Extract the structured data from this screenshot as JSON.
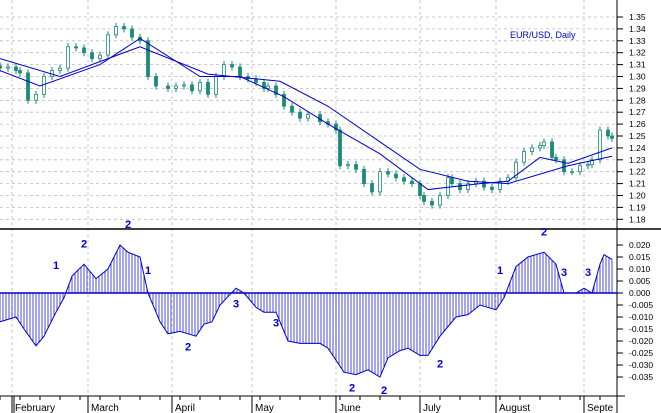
{
  "chart_data": [
    {
      "type": "candlestick",
      "title": "EUR/USD, Daily",
      "x_unit": "trading day index",
      "xlim": [
        0,
        153
      ],
      "ylim": [
        1.175,
        1.365
      ],
      "y_ticks": [
        "1.35",
        "1.34",
        "1.33",
        "1.32",
        "1.31",
        "1.30",
        "1.29",
        "1.28",
        "1.27",
        "1.26",
        "1.25",
        "1.24",
        "1.23",
        "1.22",
        "1.21",
        "1.20",
        "1.19",
        "1.18"
      ],
      "grid": true,
      "close": [
        [
          0,
          1.307
        ],
        [
          2,
          1.308
        ],
        [
          4,
          1.305
        ],
        [
          5,
          1.303
        ],
        [
          7,
          1.28
        ],
        [
          9,
          1.285
        ],
        [
          11,
          1.3
        ],
        [
          13,
          1.305
        ],
        [
          15,
          1.307
        ],
        [
          17,
          1.325
        ],
        [
          19,
          1.324
        ],
        [
          21,
          1.32
        ],
        [
          23,
          1.315
        ],
        [
          25,
          1.318
        ],
        [
          27,
          1.335
        ],
        [
          29,
          1.342
        ],
        [
          31,
          1.34
        ],
        [
          33,
          1.333
        ],
        [
          35,
          1.33
        ],
        [
          37,
          1.3
        ],
        [
          39,
          1.292
        ],
        [
          42,
          1.29
        ],
        [
          44,
          1.292
        ],
        [
          46,
          1.293
        ],
        [
          48,
          1.288
        ],
        [
          50,
          1.295
        ],
        [
          52,
          1.285
        ],
        [
          54,
          1.3
        ],
        [
          56,
          1.31
        ],
        [
          58,
          1.308
        ],
        [
          60,
          1.3
        ],
        [
          62,
          1.298
        ],
        [
          64,
          1.295
        ],
        [
          66,
          1.29
        ],
        [
          67,
          1.292
        ],
        [
          69,
          1.285
        ],
        [
          71,
          1.275
        ],
        [
          73,
          1.27
        ],
        [
          75,
          1.265
        ],
        [
          77,
          1.268
        ],
        [
          80,
          1.262
        ],
        [
          82,
          1.26
        ],
        [
          84,
          1.255
        ],
        [
          85,
          1.225
        ],
        [
          87,
          1.226
        ],
        [
          89,
          1.222
        ],
        [
          91,
          1.21
        ],
        [
          93,
          1.203
        ],
        [
          95,
          1.22
        ],
        [
          97,
          1.218
        ],
        [
          99,
          1.215
        ],
        [
          101,
          1.212
        ],
        [
          103,
          1.21
        ],
        [
          105,
          1.2
        ],
        [
          106,
          1.195
        ],
        [
          108,
          1.192
        ],
        [
          110,
          1.2
        ],
        [
          112,
          1.215
        ],
        [
          113,
          1.21
        ],
        [
          115,
          1.205
        ],
        [
          117,
          1.21
        ],
        [
          119,
          1.212
        ],
        [
          121,
          1.207
        ],
        [
          123,
          1.205
        ],
        [
          125,
          1.212
        ],
        [
          127,
          1.215
        ],
        [
          129,
          1.228
        ],
        [
          131,
          1.237
        ],
        [
          133,
          1.24
        ],
        [
          135,
          1.242
        ],
        [
          136,
          1.245
        ],
        [
          138,
          1.232
        ],
        [
          139,
          1.23
        ],
        [
          141,
          1.22
        ],
        [
          143,
          1.22
        ],
        [
          145,
          1.225
        ],
        [
          147,
          1.226
        ],
        [
          148,
          1.23
        ],
        [
          150,
          1.255
        ],
        [
          152,
          1.25
        ],
        [
          153,
          1.248
        ]
      ],
      "ma_fast": [
        [
          0,
          1.305
        ],
        [
          10,
          1.292
        ],
        [
          25,
          1.31
        ],
        [
          35,
          1.332
        ],
        [
          50,
          1.3
        ],
        [
          60,
          1.3
        ],
        [
          71,
          1.283
        ],
        [
          82,
          1.26
        ],
        [
          95,
          1.235
        ],
        [
          107,
          1.205
        ],
        [
          120,
          1.21
        ],
        [
          127,
          1.212
        ],
        [
          135,
          1.232
        ],
        [
          142,
          1.227
        ],
        [
          153,
          1.24
        ]
      ],
      "ma_slow": [
        [
          0,
          1.315
        ],
        [
          15,
          1.3
        ],
        [
          35,
          1.325
        ],
        [
          52,
          1.302
        ],
        [
          70,
          1.296
        ],
        [
          82,
          1.275
        ],
        [
          105,
          1.222
        ],
        [
          117,
          1.212
        ],
        [
          127,
          1.21
        ],
        [
          142,
          1.225
        ],
        [
          153,
          1.233
        ]
      ]
    },
    {
      "type": "area",
      "title": "Oscillator",
      "xlim": [
        0,
        153
      ],
      "ylim": [
        -0.042,
        0.025
      ],
      "y_ticks": [
        "0.020",
        "0.015",
        "0.010",
        "0.005",
        "0.000",
        "-0.005",
        "-0.010",
        "-0.015",
        "-0.020",
        "-0.025",
        "-0.030",
        "-0.035"
      ],
      "values": [
        [
          0,
          -0.012
        ],
        [
          4,
          -0.01
        ],
        [
          6,
          -0.015
        ],
        [
          9,
          -0.022
        ],
        [
          11,
          -0.018
        ],
        [
          14,
          -0.008
        ],
        [
          16,
          -0.002
        ],
        [
          18,
          0.007
        ],
        [
          21,
          0.012
        ],
        [
          24,
          0.006
        ],
        [
          27,
          0.01
        ],
        [
          30,
          0.02
        ],
        [
          32,
          0.017
        ],
        [
          35,
          0.015
        ],
        [
          37,
          0.0
        ],
        [
          40,
          -0.012
        ],
        [
          42,
          -0.017
        ],
        [
          45,
          -0.016
        ],
        [
          49,
          -0.018
        ],
        [
          51,
          -0.013
        ],
        [
          53,
          -0.012
        ],
        [
          55,
          -0.005
        ],
        [
          59,
          0.002
        ],
        [
          61,
          0.0
        ],
        [
          64,
          -0.006
        ],
        [
          66,
          -0.008
        ],
        [
          69,
          -0.008
        ],
        [
          72,
          -0.02
        ],
        [
          75,
          -0.021
        ],
        [
          80,
          -0.021
        ],
        [
          82,
          -0.023
        ],
        [
          86,
          -0.033
        ],
        [
          89,
          -0.034
        ],
        [
          92,
          -0.032
        ],
        [
          95,
          -0.035
        ],
        [
          97,
          -0.027
        ],
        [
          100,
          -0.024
        ],
        [
          102,
          -0.023
        ],
        [
          105,
          -0.026
        ],
        [
          107,
          -0.026
        ],
        [
          110,
          -0.018
        ],
        [
          114,
          -0.01
        ],
        [
          117,
          -0.009
        ],
        [
          120,
          -0.005
        ],
        [
          124,
          -0.007
        ],
        [
          126,
          -0.002
        ],
        [
          129,
          0.011
        ],
        [
          132,
          0.015
        ],
        [
          136,
          0.017
        ],
        [
          139,
          0.012
        ],
        [
          141,
          0.0
        ],
        [
          144,
          0.0
        ],
        [
          146,
          0.002
        ],
        [
          148,
          0.0
        ],
        [
          150,
          0.012
        ],
        [
          151,
          0.016
        ],
        [
          153,
          0.014
        ]
      ],
      "wave_labels": [
        {
          "text": "1",
          "day": 14,
          "value": 0.01
        },
        {
          "text": "2",
          "day": 21,
          "value": 0.019
        },
        {
          "text": "2",
          "day": 32,
          "value": 0.027
        },
        {
          "text": "1",
          "day": 37,
          "value": 0.008
        },
        {
          "text": "2",
          "day": 47,
          "value": -0.024
        },
        {
          "text": "3",
          "day": 59,
          "value": -0.006
        },
        {
          "text": "3",
          "day": 69,
          "value": -0.014
        },
        {
          "text": "2",
          "day": 88,
          "value": -0.041
        },
        {
          "text": "2",
          "day": 96,
          "value": -0.042
        },
        {
          "text": "2",
          "day": 110,
          "value": -0.031
        },
        {
          "text": "1",
          "day": 125,
          "value": 0.008
        },
        {
          "text": "2",
          "day": 136,
          "value": 0.024
        },
        {
          "text": "3",
          "day": 141,
          "value": 0.007
        },
        {
          "text": "3",
          "day": 147,
          "value": 0.007
        }
      ]
    }
  ],
  "x_axis": {
    "months": [
      {
        "label": "February",
        "day": 3
      },
      {
        "label": "March",
        "day": 22
      },
      {
        "label": "April",
        "day": 43
      },
      {
        "label": "May",
        "day": 63
      },
      {
        "label": "June",
        "day": 84
      },
      {
        "label": "July",
        "day": 105
      },
      {
        "label": "August",
        "day": 124
      },
      {
        "label": "Septe",
        "day": 146
      }
    ]
  },
  "colors": {
    "bull": "#1a8a7a",
    "line": "#0000cc",
    "grid": "#bbbbbb",
    "label": "#0000cc"
  }
}
